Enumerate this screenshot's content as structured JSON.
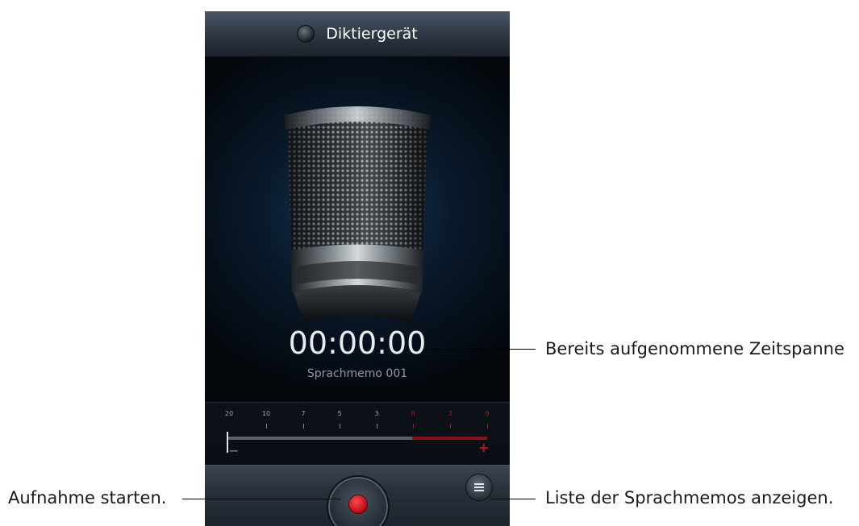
{
  "app": {
    "title": "Diktiergerät"
  },
  "recorder": {
    "elapsed_time": "00:00:00",
    "memo_name": "Sprachmemo 001"
  },
  "level_meter": {
    "scale": [
      {
        "label": "20",
        "red": false
      },
      {
        "label": "10",
        "red": false
      },
      {
        "label": "7",
        "red": false
      },
      {
        "label": "5",
        "red": false
      },
      {
        "label": "3",
        "red": false
      },
      {
        "label": "0",
        "red": true
      },
      {
        "label": "3",
        "red": true
      },
      {
        "label": "9",
        "red": true
      }
    ],
    "minus_symbol": "−",
    "plus_symbol": "+"
  },
  "callouts": {
    "elapsed_time": "Bereits aufgenommene Zeitspanne",
    "start_recording": "Aufnahme starten.",
    "memo_list": "Liste der Sprachmemos anzeigen."
  },
  "icons": {
    "app": "recorder-icon",
    "microphone": "microphone-icon",
    "record": "record-icon",
    "list": "list-icon"
  },
  "colors": {
    "record_red": "#d7141b",
    "meter_red": "#b8171d",
    "background_blue": "#17385a"
  }
}
